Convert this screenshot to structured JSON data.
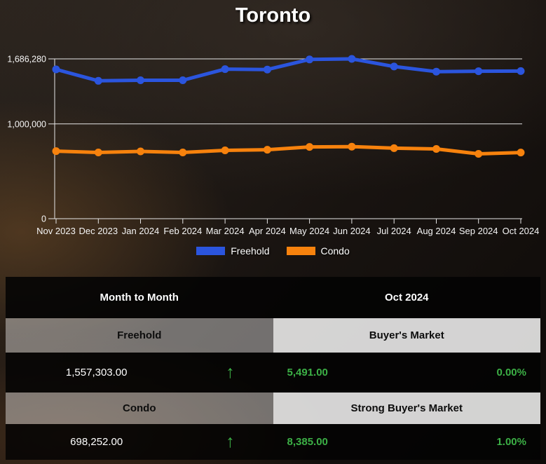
{
  "chart_data": {
    "type": "line",
    "title": "Toronto",
    "categories": [
      "Nov 2023",
      "Dec 2023",
      "Jan 2024",
      "Feb 2024",
      "Mar 2024",
      "Apr 2024",
      "May 2024",
      "Jun 2024",
      "Jul 2024",
      "Aug 2024",
      "Sep 2024",
      "Oct 2024"
    ],
    "series": [
      {
        "name": "Freehold",
        "color": "#2b55de",
        "values": [
          1575000,
          1455000,
          1461000,
          1461000,
          1578000,
          1574000,
          1680000,
          1686280,
          1606000,
          1552000,
          1556000,
          1557303
        ]
      },
      {
        "name": "Condo",
        "color": "#f7820d",
        "values": [
          713000,
          699000,
          710000,
          699000,
          721000,
          728000,
          757000,
          760000,
          744000,
          736000,
          684000,
          698252
        ]
      }
    ],
    "ylim": [
      0,
      1686280
    ],
    "yticks": [
      {
        "value": 0,
        "label": "0"
      },
      {
        "value": 1000000,
        "label": "1,000,000"
      },
      {
        "value": 1686280,
        "label": "1,686,280"
      }
    ],
    "grid": true,
    "legend_position": "bottom"
  },
  "icons": {
    "up_arrow": "↑"
  },
  "colors": {
    "freehold": "#2b55de",
    "condo": "#f7820d",
    "positive_green": "#3cb046",
    "header_bg": "#030303",
    "band_left_bg": "#6b6968",
    "band_right_bg": "#cccccc"
  },
  "table": {
    "column_headers": [
      "Month to Month",
      "Oct 2024"
    ],
    "rows": [
      {
        "label": "Freehold",
        "status": "Buyer's Market",
        "price": "1,557,303.00",
        "trend": "up",
        "value": "5,491.00",
        "percent": "0.00%"
      },
      {
        "label": "Condo",
        "status": "Strong Buyer's Market",
        "price": "698,252.00",
        "trend": "up",
        "value": "8,385.00",
        "percent": "1.00%"
      }
    ]
  }
}
